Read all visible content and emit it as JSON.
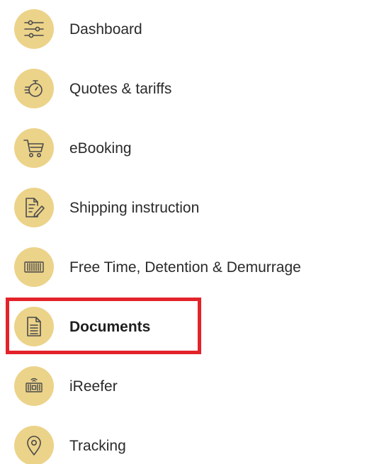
{
  "colors": {
    "icon_circle": "#ecd38a",
    "icon_stroke": "#4a4a4a",
    "highlight": "#e3232a",
    "text": "#2a2a2a"
  },
  "menu": {
    "items": [
      {
        "label": "Dashboard",
        "icon": "sliders-icon",
        "active": false
      },
      {
        "label": "Quotes & tariffs",
        "icon": "stopwatch-icon",
        "active": false
      },
      {
        "label": "eBooking",
        "icon": "shopping-cart-icon",
        "active": false
      },
      {
        "label": "Shipping instruction",
        "icon": "document-edit-icon",
        "active": false
      },
      {
        "label": "Free Time, Detention & Demurrage",
        "icon": "container-icon",
        "active": false
      },
      {
        "label": "Documents",
        "icon": "document-icon",
        "active": true
      },
      {
        "label": "iReefer",
        "icon": "reefer-container-icon",
        "active": false
      },
      {
        "label": "Tracking",
        "icon": "location-pin-icon",
        "active": false
      }
    ]
  }
}
